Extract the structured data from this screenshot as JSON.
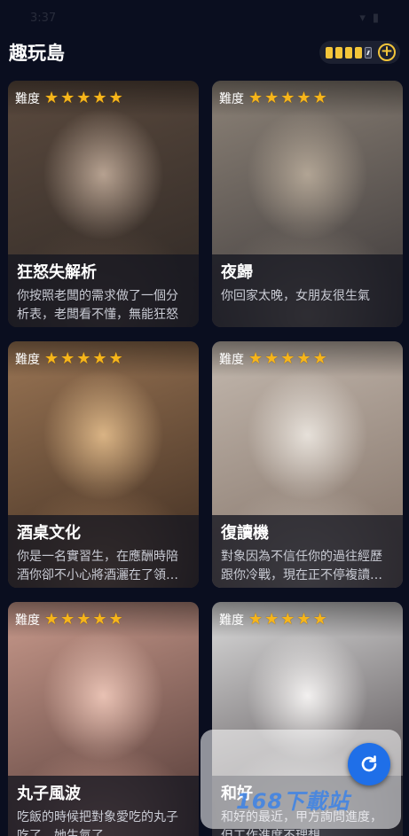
{
  "status": {
    "time": "3:37",
    "battery": ""
  },
  "header": {
    "title": "趣玩島",
    "add_symbol": "+",
    "energy_full": 4,
    "energy_total": 5
  },
  "difficulty_label": "難度",
  "cards": [
    {
      "name": "狂怒失解析",
      "desc": "你按照老闆的需求做了一個分析表，老闆看不懂，無能狂怒",
      "stars": 5,
      "palette": [
        "#5b4a3e",
        "#2d2724",
        "#b6a190"
      ]
    },
    {
      "name": "夜歸",
      "desc": "你回家太晚，女朋友很生氣",
      "stars": 5,
      "palette": [
        "#8c8277",
        "#3a3637",
        "#b1a494"
      ]
    },
    {
      "name": "酒桌文化",
      "desc": "你是一名實習生，在應酬時陪酒你卻不小心將酒灑在了領導身上",
      "stars": 5,
      "palette": [
        "#9a7554",
        "#3b2a1f",
        "#d9b384"
      ]
    },
    {
      "name": "復讀機",
      "desc": "對象因為不信任你的過往經歷跟你冷戰，現在正不停複讀她的問題",
      "stars": 5,
      "palette": [
        "#c3b8ae",
        "#7e6d62",
        "#e6e0d9"
      ]
    },
    {
      "name": "丸子風波",
      "desc": "吃飯的時候把對象愛吃的丸子吃了，她生氣了",
      "stars": 5,
      "palette": [
        "#c99a8c",
        "#4b3431",
        "#e8c1b3"
      ]
    },
    {
      "name": "和好",
      "desc": "和好的最近，甲方詢問進度，但工作進度不理想",
      "stars": 5,
      "palette": [
        "#dcdcdc",
        "#3a3336",
        "#f2f0ef"
      ]
    }
  ],
  "watermark": {
    "text": "168下載站"
  }
}
